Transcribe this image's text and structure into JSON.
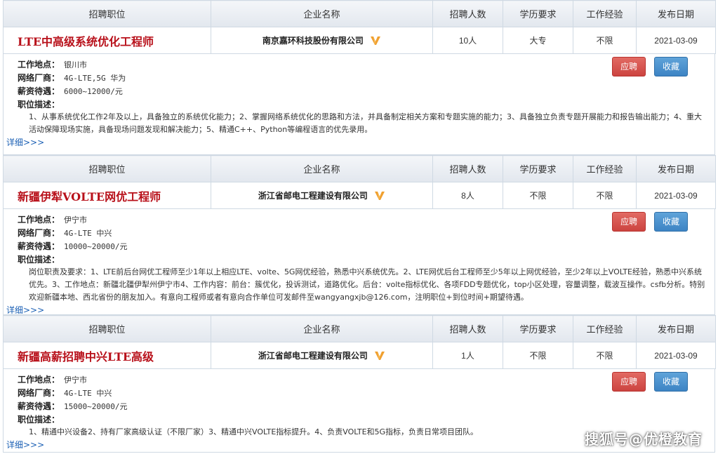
{
  "headers": {
    "position": "招聘职位",
    "company": "企业名称",
    "count": "招聘人数",
    "education": "学历要求",
    "experience": "工作经验",
    "date": "发布日期"
  },
  "labels": {
    "location": "工作地点：",
    "vendor": "网络厂商：",
    "salary": "薪资待遇：",
    "desc": "职位描述：",
    "more": "详细>>>",
    "apply": "应聘",
    "save": "收藏"
  },
  "jobs": [
    {
      "title": "LTE中高级系统优化工程师",
      "company": "南京嘉环科技股份有限公司",
      "count": "10人",
      "education": "大专",
      "experience": "不限",
      "date": "2021-03-09",
      "location": "银川市",
      "vendor": "4G-LTE,5G 华为",
      "salary": "6000~12000/元",
      "desc": "1、从事系统优化工作2年及以上，具备独立的系统优化能力；2、掌握网络系统优化的思路和方法，并具备制定相关方案和专题实施的能力；3、具备独立负责专题开展能力和报告输出能力；4、重大活动保障现场实施，具备现场问题发现和解决能力；5、精通C++、Python等编程语言的优先录用。"
    },
    {
      "title": "新疆伊犁VOLTE网优工程师",
      "company": "浙江省邮电工程建设有限公司",
      "count": "8人",
      "education": "不限",
      "experience": "不限",
      "date": "2021-03-09",
      "location": "伊宁市",
      "vendor": "4G-LTE 中兴",
      "salary": "10000~20000/元",
      "desc": "岗位职责及要求：1、LTE前后台网优工程师至少1年以上相应LTE、volte、5G网优经验，熟悉中兴系统优先。2、LTE网优后台工程师至少5年以上网优经验，至少2年以上VOLTE经验，熟悉中兴系统优先。3、工作地点：新疆北疆伊犁州伊宁市4、工作内容：前台：簇优化，投诉测试，道路优化。后台：volte指标优化、各项FDD专题优化，top小区处理，容量调整，载波互操作。csfb分析。特别欢迎新疆本地、西北省份的朋友加入。有意向工程师或者有意向合作单位可发邮件至wangyangxjb@126.com，注明职位+到位时间+期望待遇。"
    },
    {
      "title": "新疆高薪招聘中兴LTE高级",
      "company": "浙江省邮电工程建设有限公司",
      "count": "1人",
      "education": "不限",
      "experience": "不限",
      "date": "2021-03-09",
      "location": "伊宁市",
      "vendor": "4G-LTE 中兴",
      "salary": "15000~20000/元",
      "desc": "1、精通中兴设备2、持有厂家高级认证（不限厂家）3、精通中兴VOLTE指标提升。4、负责VOLTE和5G指标，负责日常项目团队。"
    }
  ],
  "watermark": "搜狐号@优橙教育",
  "colors": {
    "title_red": "#b8101a",
    "apply_red": "#d9534f",
    "save_blue": "#4a90d0",
    "link_blue": "#1a5fb4",
    "badge_orange": "#f0a030"
  }
}
